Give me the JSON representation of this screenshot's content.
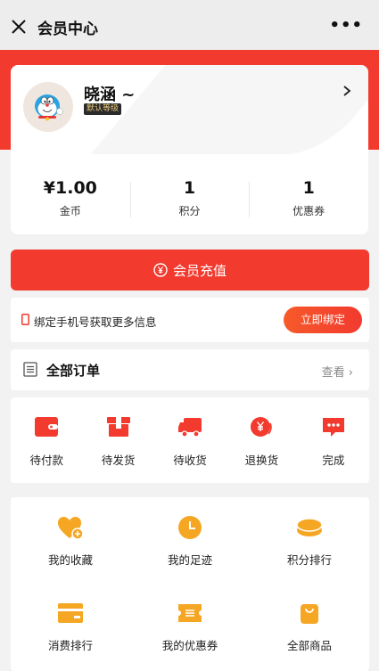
{
  "nav": {
    "title": "会员中心",
    "more": "•••"
  },
  "profile": {
    "name": "晓涵 ~",
    "level": "默认等级"
  },
  "stats": [
    {
      "value": "¥1.00",
      "label": "金币"
    },
    {
      "value": "1",
      "label": "积分"
    },
    {
      "value": "1",
      "label": "优惠券"
    }
  ],
  "recharge": {
    "label": "会员充值"
  },
  "bind": {
    "text": "绑定手机号获取更多信息",
    "button": "立即绑定"
  },
  "orders": {
    "title": "全部订单",
    "view": "查看 ›",
    "items": [
      {
        "label": "待付款",
        "icon": "wallet-icon"
      },
      {
        "label": "待发货",
        "icon": "package-icon"
      },
      {
        "label": "待收货",
        "icon": "truck-icon"
      },
      {
        "label": "退换货",
        "icon": "refund-icon"
      },
      {
        "label": "完成",
        "icon": "chat-bubble-icon"
      }
    ]
  },
  "tools": [
    {
      "label": "我的收藏",
      "icon": "heart-plus-icon"
    },
    {
      "label": "我的足迹",
      "icon": "clock-icon"
    },
    {
      "label": "积分排行",
      "icon": "coins-icon"
    },
    {
      "label": "消费排行",
      "icon": "card-icon"
    },
    {
      "label": "我的优惠券",
      "icon": "ticket-icon"
    },
    {
      "label": "全部商品",
      "icon": "bag-icon"
    }
  ],
  "colors": {
    "accent": "#f23a2f",
    "orange": "#f5a623"
  }
}
